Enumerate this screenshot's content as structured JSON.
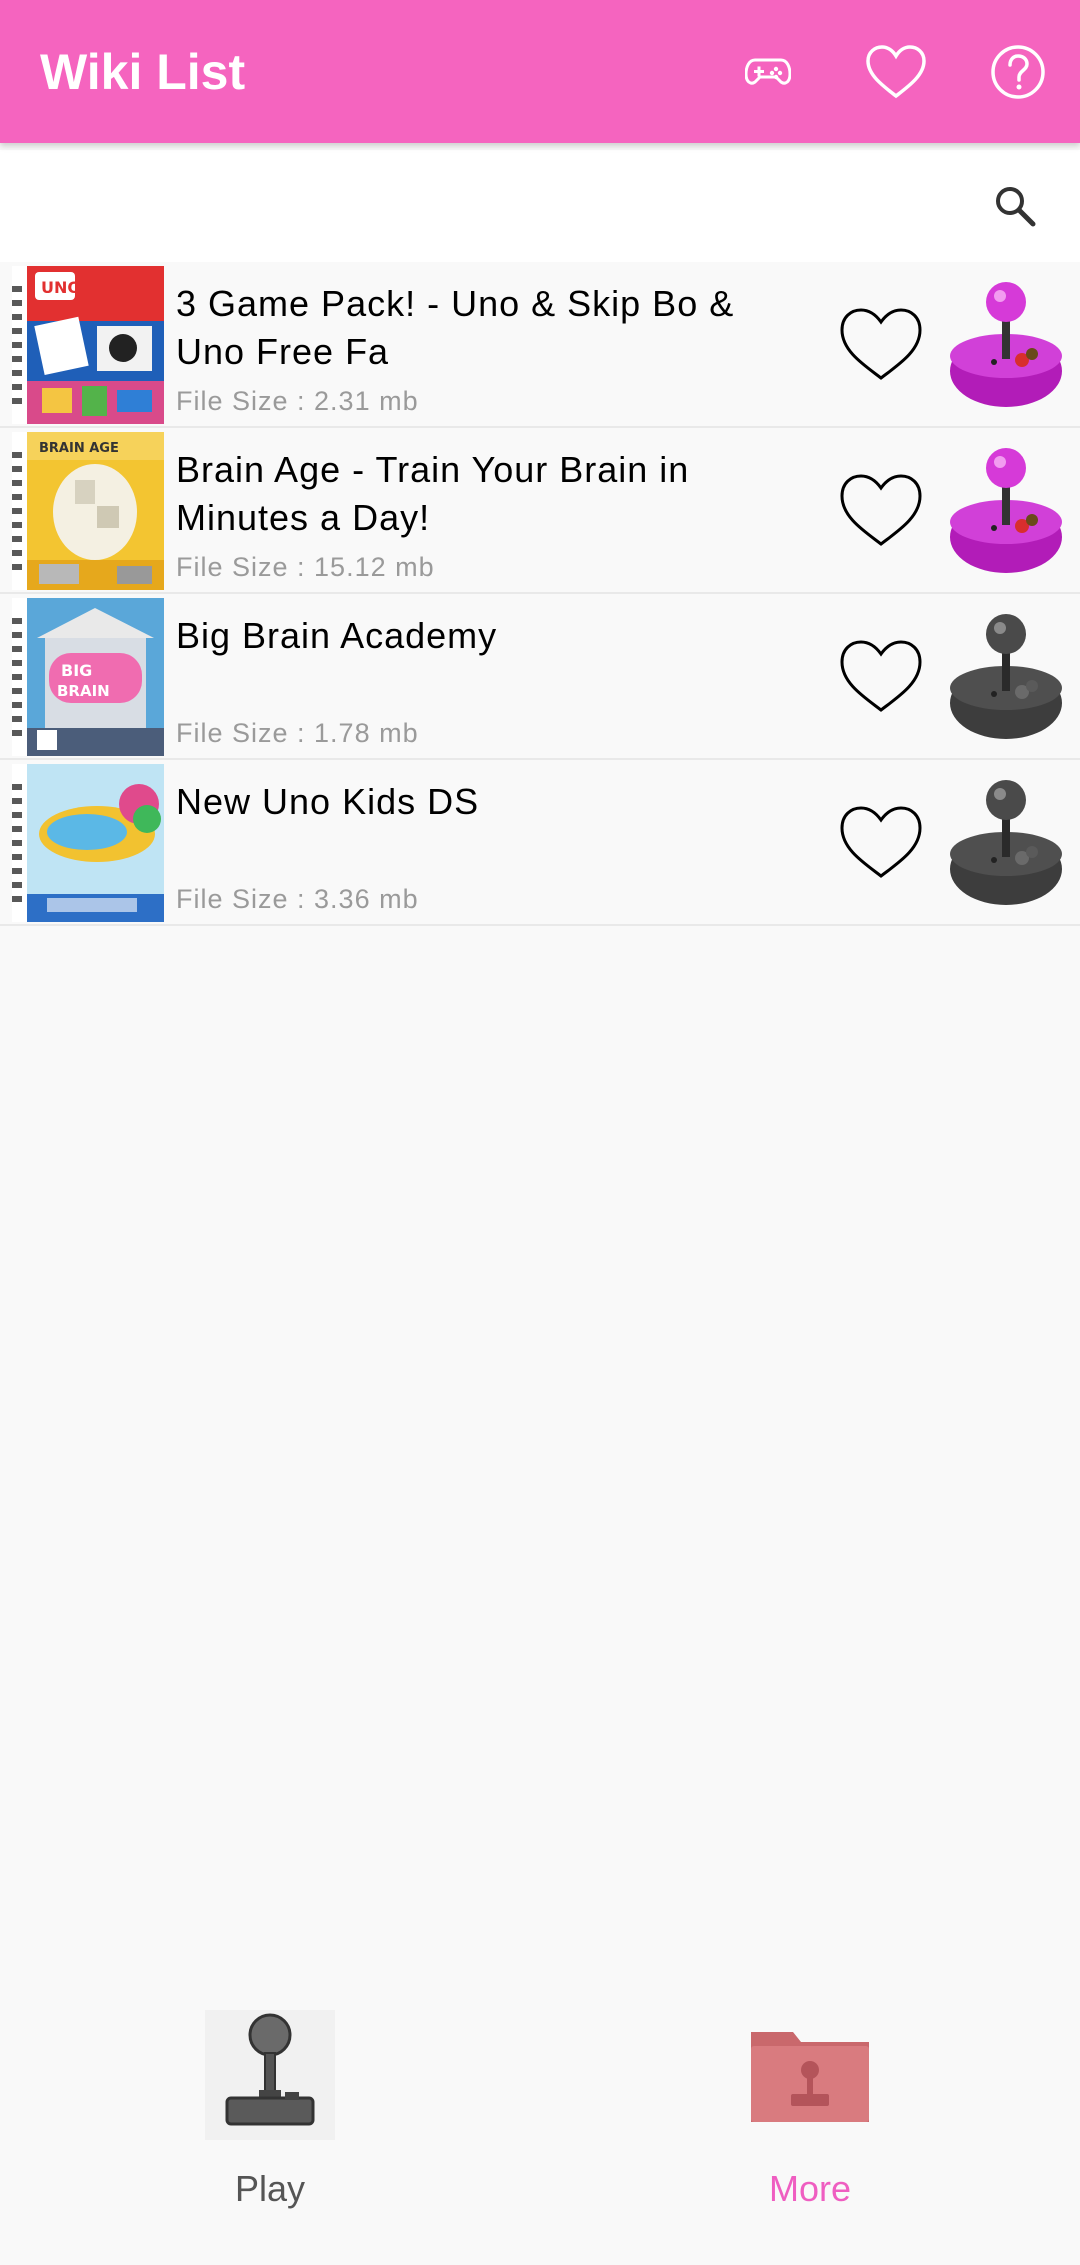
{
  "app_bar": {
    "title": "Wiki List",
    "background": "#f564bf",
    "icons": [
      "gamepad-icon",
      "heart-icon",
      "help-icon"
    ]
  },
  "search": {
    "icon": "search-icon"
  },
  "games": [
    {
      "title": "3 Game Pack! - Uno & Skip Bo & Uno Free Fa",
      "size": "File Size : 2.31 mb",
      "active": true
    },
    {
      "title": "Brain Age - Train Your Brain in Minutes a Day!",
      "size": "File Size : 15.12 mb",
      "active": true
    },
    {
      "title": "Big Brain Academy",
      "size": "File Size : 1.78 mb",
      "active": false
    },
    {
      "title": "New Uno Kids DS",
      "size": "File Size : 3.36 mb",
      "active": false
    }
  ],
  "bottom_nav": {
    "play_label": "Play",
    "more_label": "More",
    "active_color": "#ef5ec1",
    "inactive_color": "#555555"
  }
}
